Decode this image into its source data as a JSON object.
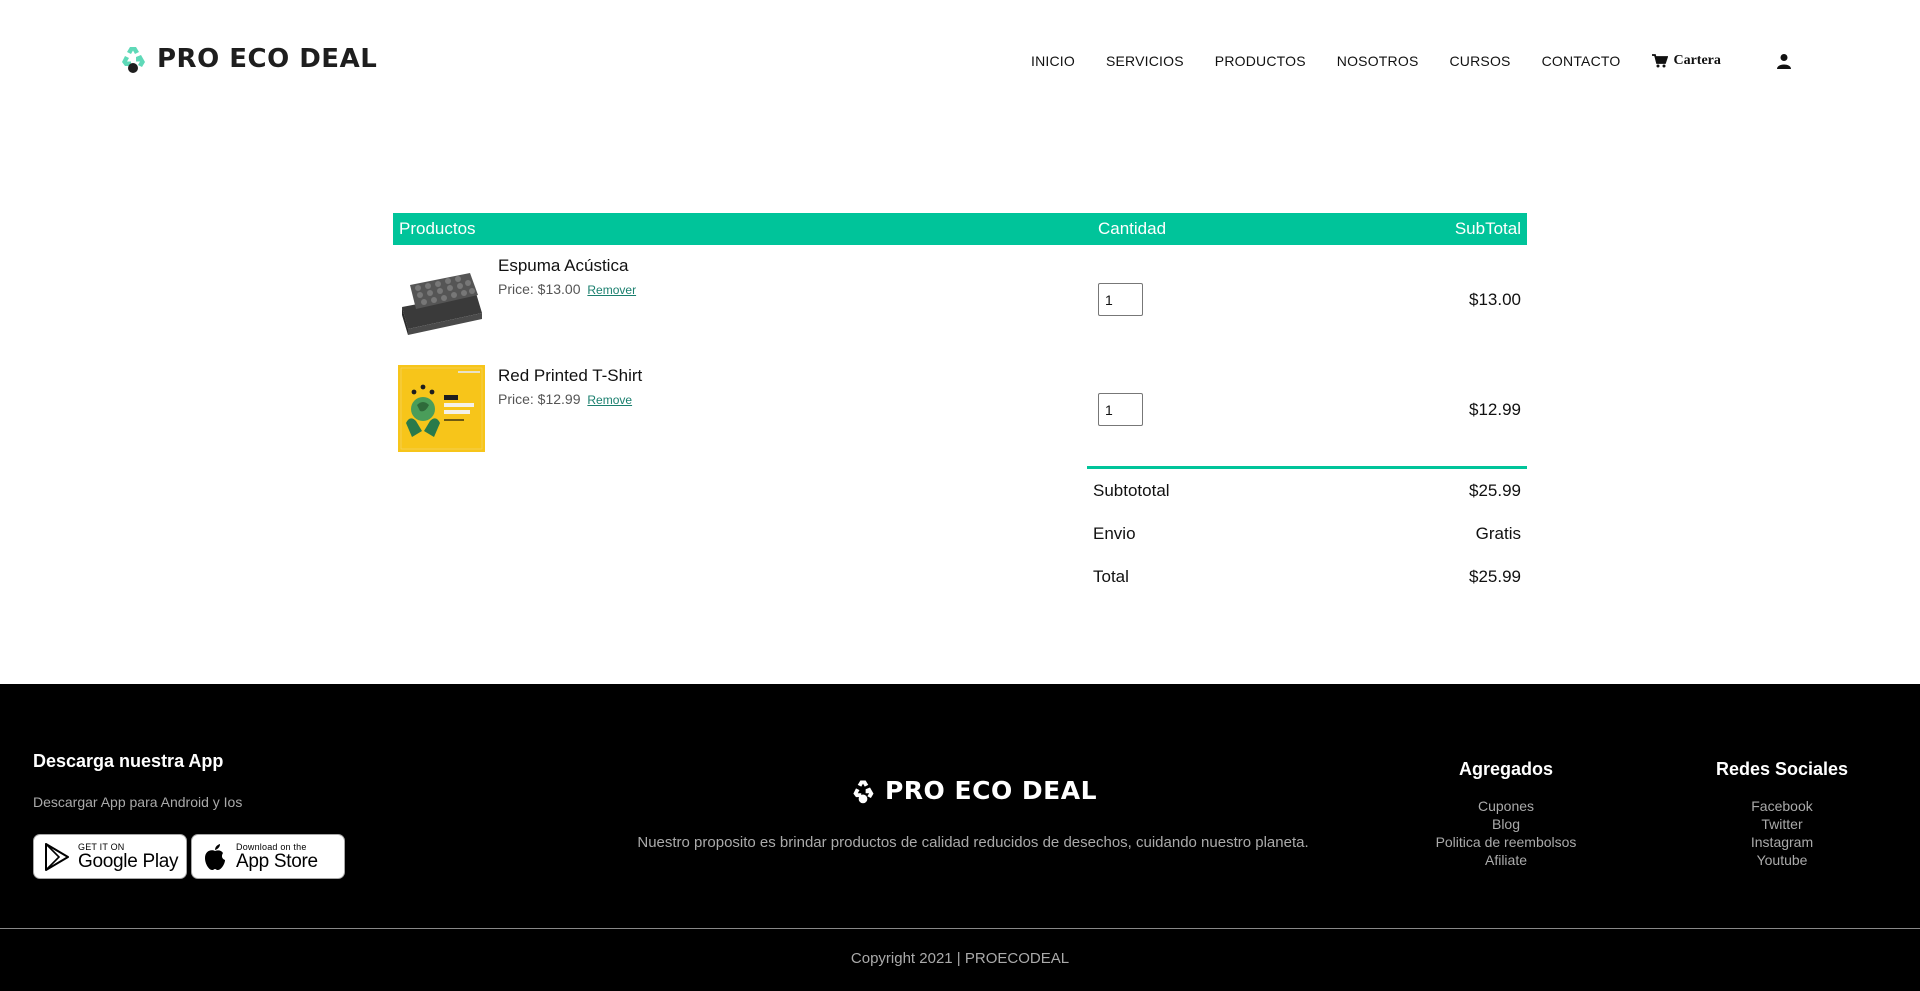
{
  "brand": {
    "name": "PRO ECO DEAL",
    "accent": "#00c49a",
    "logo_icon": "recycle-icon"
  },
  "nav": {
    "items": [
      "INICIO",
      "SERVICIOS",
      "PRODUCTOS",
      "NOSOTROS",
      "CURSOS",
      "CONTACTO"
    ],
    "cart_label": "Cartera",
    "cart_icon": "shopping-cart-icon",
    "user_icon": "user-icon"
  },
  "cart": {
    "headers": {
      "products": "Productos",
      "quantity": "Cantidad",
      "subtotal": "SubTotal"
    },
    "items": [
      {
        "name": "Espuma Acústica",
        "price": "Price: $13.00",
        "remove": "Remover",
        "qty": "1",
        "subtotal": "$13.00",
        "image": "acoustic-foam-image"
      },
      {
        "name": "Red Printed T-Shirt",
        "price": "Price: $12.99",
        "remove": "Remove",
        "qty": "1",
        "subtotal": "$12.99",
        "image": "eco-poster-image"
      }
    ],
    "totals": [
      {
        "label": "Subtototal",
        "value": "$25.99"
      },
      {
        "label": "Envio",
        "value": "Gratis"
      },
      {
        "label": "Total",
        "value": "$25.99"
      }
    ]
  },
  "footer": {
    "app_title": "Descarga nuestra App",
    "app_desc": "Descargar App para Android y Ios",
    "google_play": {
      "small": "GET IT ON",
      "big": "Google Play"
    },
    "app_store": {
      "small": "Download on the",
      "big": "App Store"
    },
    "brand": "PRO ECO DEAL",
    "purpose": "Nuestro proposito es brindar productos de calidad reducidos de desechos, cuidando nuestro planeta.",
    "agregados": {
      "title": "Agregados",
      "links": [
        "Cupones",
        "Blog",
        "Politica de reembolsos",
        "Afiliate"
      ]
    },
    "redes": {
      "title": "Redes Sociales",
      "links": [
        "Facebook",
        "Twitter",
        "Instagram",
        "Youtube"
      ]
    },
    "copyright": "Copyright 2021 | PROECODEAL"
  }
}
